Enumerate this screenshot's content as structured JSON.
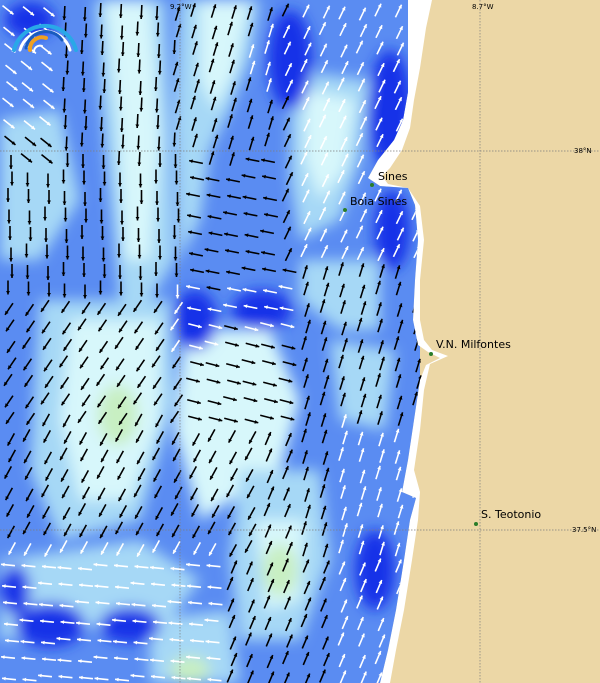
{
  "map": {
    "type": "ocean current map",
    "colors": {
      "land": "#ecd7a6",
      "sea_fast": "#1230e8",
      "sea_medium": "#5a8cf2",
      "sea_slow": "#a6d8f6",
      "sea_calm": "#d7f7fb",
      "sea_very_calm": "#c8efc2",
      "arrow_dark": "#000000",
      "arrow_light": "#ffffff",
      "coastline": "#ffffff",
      "grid": "#7d7d7d",
      "place_marker": "#2a7d2a"
    },
    "grid_labels": {
      "lon_west": "9.2°W",
      "lon_east": "8.7°W",
      "lat_north": "38°N",
      "lat_south": "37.5°N"
    },
    "places": [
      {
        "name": "Sines"
      },
      {
        "name": "Boia Sines"
      },
      {
        "name": "V.N. Milfontes"
      },
      {
        "name": "S. Teotonio"
      }
    ],
    "logo": {
      "icon": "wave-arc-logo"
    }
  }
}
